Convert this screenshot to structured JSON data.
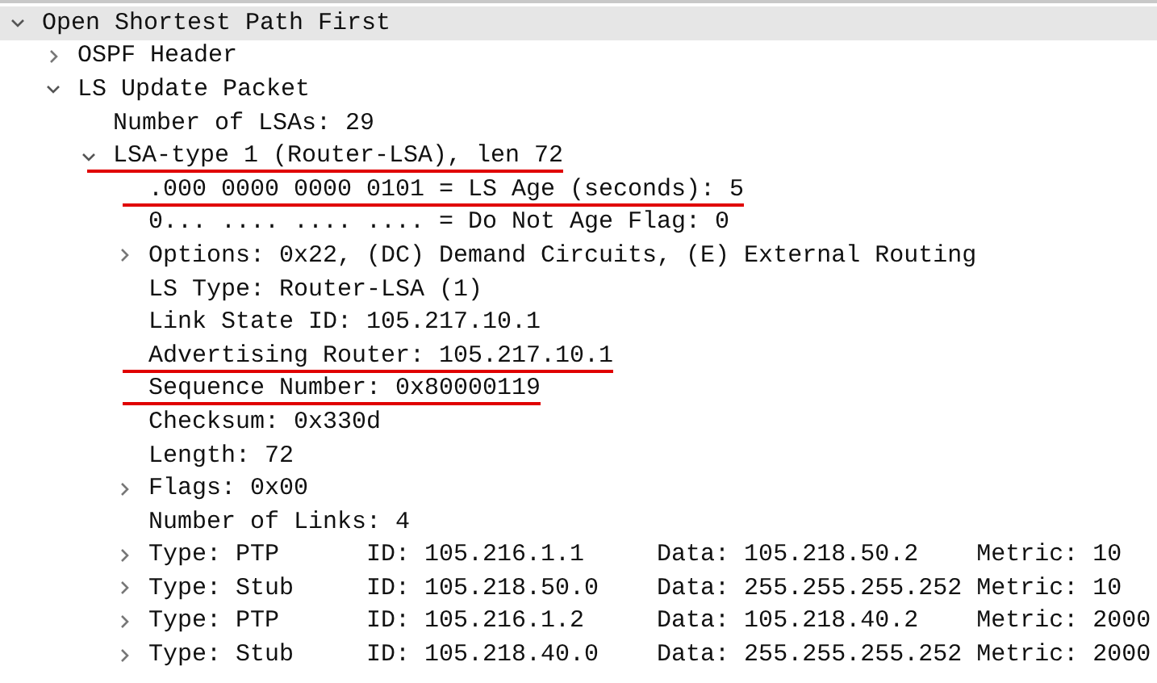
{
  "tree": [
    {
      "text": "Open Shortest Path First",
      "kind": "branch",
      "expanded": true,
      "selected": true,
      "marked": false,
      "children": [
        {
          "text": "OSPF Header",
          "kind": "branch",
          "expanded": false,
          "selected": false,
          "marked": false
        },
        {
          "text": "LS Update Packet",
          "kind": "branch",
          "expanded": true,
          "selected": false,
          "marked": false,
          "children": [
            {
              "text": "Number of LSAs: 29",
              "kind": "leaf",
              "selected": false,
              "marked": false
            },
            {
              "text": "LSA-type 1 (Router-LSA), len 72",
              "kind": "branch",
              "expanded": true,
              "selected": false,
              "marked": true,
              "children": [
                {
                  "text": ".000 0000 0000 0101 = LS Age (seconds): 5",
                  "kind": "leaf",
                  "selected": false,
                  "marked": true
                },
                {
                  "text": "0... .... .... .... = Do Not Age Flag: 0",
                  "kind": "leaf",
                  "selected": false,
                  "marked": false
                },
                {
                  "text": "Options: 0x22, (DC) Demand Circuits, (E) External Routing",
                  "kind": "branch",
                  "expanded": false,
                  "selected": false,
                  "marked": false
                },
                {
                  "text": "LS Type: Router-LSA (1)",
                  "kind": "leaf",
                  "selected": false,
                  "marked": false
                },
                {
                  "text": "Link State ID: 105.217.10.1",
                  "kind": "leaf",
                  "selected": false,
                  "marked": false
                },
                {
                  "text": "Advertising Router: 105.217.10.1",
                  "kind": "leaf",
                  "selected": false,
                  "marked": true
                },
                {
                  "text": "Sequence Number: 0x80000119",
                  "kind": "leaf",
                  "selected": false,
                  "marked": true
                },
                {
                  "text": "Checksum: 0x330d",
                  "kind": "leaf",
                  "selected": false,
                  "marked": false
                },
                {
                  "text": "Length: 72",
                  "kind": "leaf",
                  "selected": false,
                  "marked": false
                },
                {
                  "text": "Flags: 0x00",
                  "kind": "branch",
                  "expanded": false,
                  "selected": false,
                  "marked": false
                },
                {
                  "text": "Number of Links: 4",
                  "kind": "leaf",
                  "selected": false,
                  "marked": false
                },
                {
                  "text": "Type: PTP      ID: 105.216.1.1     Data: 105.218.50.2    Metric: 10",
                  "kind": "branch",
                  "expanded": false,
                  "selected": false,
                  "marked": false
                },
                {
                  "text": "Type: Stub     ID: 105.218.50.0    Data: 255.255.255.252 Metric: 10",
                  "kind": "branch",
                  "expanded": false,
                  "selected": false,
                  "marked": false
                },
                {
                  "text": "Type: PTP      ID: 105.216.1.2     Data: 105.218.40.2    Metric: 2000",
                  "kind": "branch",
                  "expanded": false,
                  "selected": false,
                  "marked": false
                },
                {
                  "text": "Type: Stub     ID: 105.218.40.0    Data: 255.255.255.252 Metric: 2000",
                  "kind": "branch",
                  "expanded": false,
                  "selected": false,
                  "marked": false
                }
              ]
            }
          ]
        }
      ]
    }
  ]
}
